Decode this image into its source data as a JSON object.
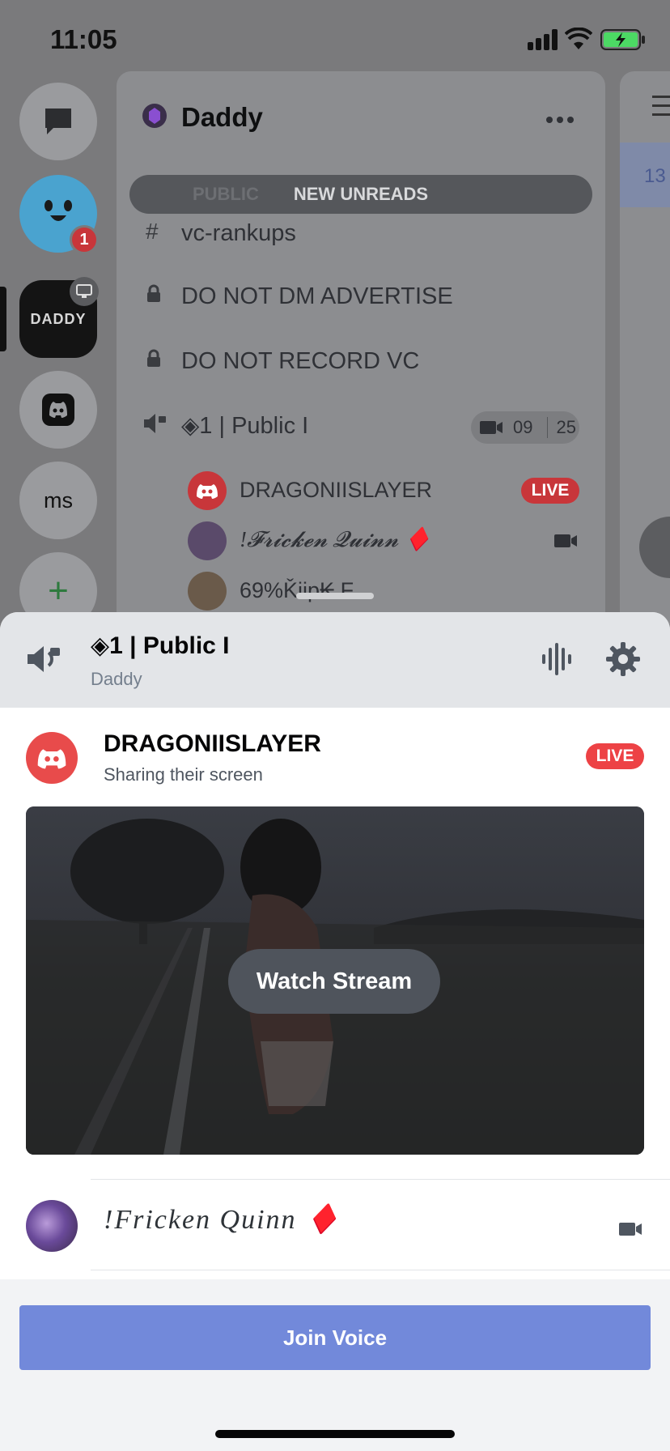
{
  "status_bar": {
    "time": "11:05"
  },
  "server_rail": {
    "badge_count": "1",
    "server_logo_text": "DADDY",
    "ms_label": "ms",
    "add_label": "+"
  },
  "channel_list": {
    "guild_name": "Daddy",
    "new_unreads": "NEW UNREADS",
    "hidden_category": "PUBLIC",
    "channels": [
      {
        "name": "vc-rankups"
      },
      {
        "name": "DO NOT DM ADVERTISE"
      },
      {
        "name": "DO NOT RECORD VC"
      },
      {
        "name": "◈1 | Public I"
      }
    ],
    "video_count": "09",
    "user_limit": "25",
    "members": [
      {
        "name": "DRAGONIISLAYER",
        "live": "LIVE"
      },
      {
        "name": "!𝓕𝓻𝓲𝓬𝓴𝓮𝓷 𝓠𝓾𝓲𝓷𝓷 ♦️"
      },
      {
        "name": "69%Ǩiip₭ F"
      }
    ],
    "right_badge": "13"
  },
  "sheet": {
    "channel_name": "◈1 | Public I",
    "guild_name": "Daddy",
    "streamer": {
      "name": "DRAGONIISLAYER",
      "status": "Sharing their screen",
      "live": "LIVE"
    },
    "watch_stream": "Watch Stream",
    "member": {
      "name": "!Fricken Quinn ♦️"
    },
    "join_voice": "Join Voice"
  },
  "colors": {
    "live_red": "#ed4245",
    "blurple": "#7289da",
    "discord_red": "#e84b4b"
  }
}
